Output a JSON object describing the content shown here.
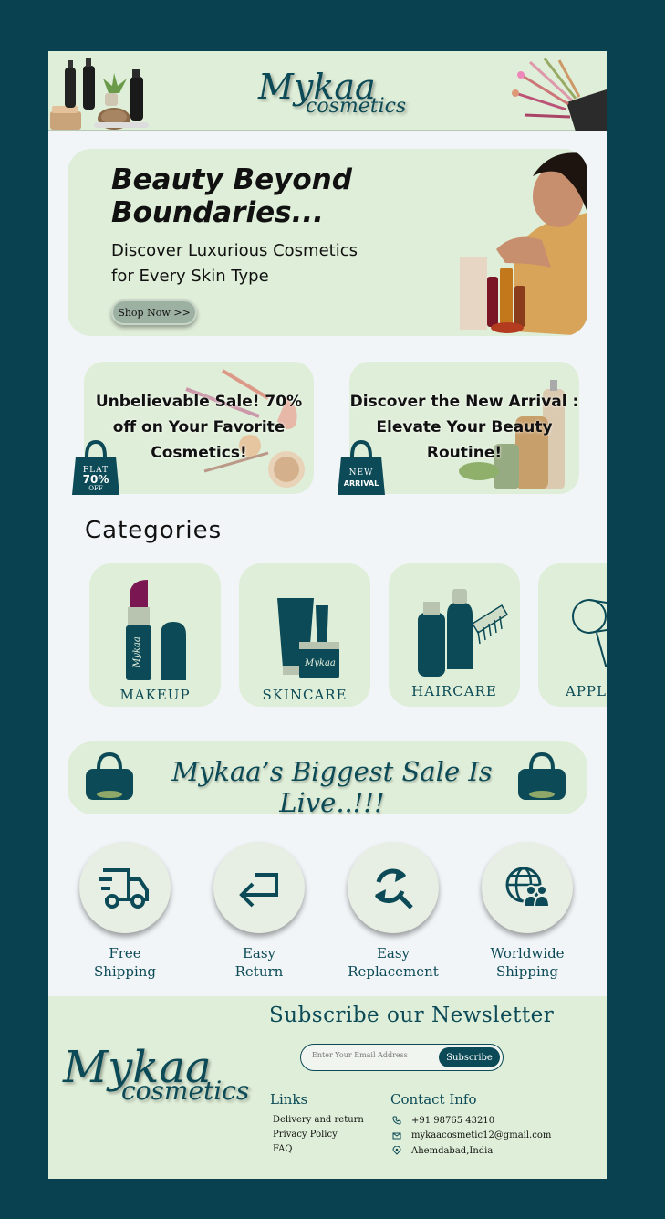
{
  "header": {
    "logo_line1": "Mykaa",
    "logo_line2": "cosmetics"
  },
  "hero": {
    "title": "Beauty Beyond Boundaries...",
    "subtitle": "Discover Luxurious Cosmetics for Every Skin Type",
    "button": "Shop Now >>"
  },
  "promos": [
    {
      "text": "Unbelievable Sale! 70% off on Your Favorite Cosmetics!",
      "tag_line1": "FLAT",
      "tag_line2": "70%",
      "tag_line3": "OFF"
    },
    {
      "text": "Discover the New Arrival : Elevate Your Beauty Routine!",
      "tag_line1": "NEW",
      "tag_line2": "ARRIVAL"
    }
  ],
  "categories": {
    "title": "Categories",
    "items": [
      {
        "label": "MAKEUP",
        "icon": "lipstick-icon"
      },
      {
        "label": "SKINCARE",
        "icon": "skincare-tubes-icon"
      },
      {
        "label": "HAIRCARE",
        "icon": "haircare-bottles-icon"
      },
      {
        "label": "APPL",
        "icon": "hair-dryer-icon"
      }
    ]
  },
  "sale_banner": {
    "text": "Mykaa’s Biggest Sale Is Live..!!!"
  },
  "features": [
    {
      "line1": "Free",
      "line2": "Shipping",
      "icon": "truck-icon"
    },
    {
      "line1": "Easy",
      "line2": "Return",
      "icon": "return-arrow-icon"
    },
    {
      "line1": "Easy",
      "line2": "Replacement",
      "icon": "replacement-icon"
    },
    {
      "line1": "Worldwide",
      "line2": "Shipping",
      "icon": "globe-users-icon"
    }
  ],
  "footer": {
    "logo_line1": "Mykaa",
    "logo_line2": "cosmetics",
    "newsletter_title": "Subscribe our Newsletter",
    "email_placeholder": "Enter Your Email Address",
    "subscribe_button": "Subscribe",
    "links_title": "Links",
    "links": [
      "Delivery and return",
      "Privacy Policy",
      "FAQ"
    ],
    "contact_title": "Contact Info",
    "phone": "+91 98765 43210",
    "email": "mykaacosmetic12@gmail.com",
    "address": "Ahemdabad,India"
  },
  "colors": {
    "background": "#0a4150",
    "panel": "#dfeed8",
    "accent": "#0b4a56",
    "page": "#f1f5f7"
  }
}
